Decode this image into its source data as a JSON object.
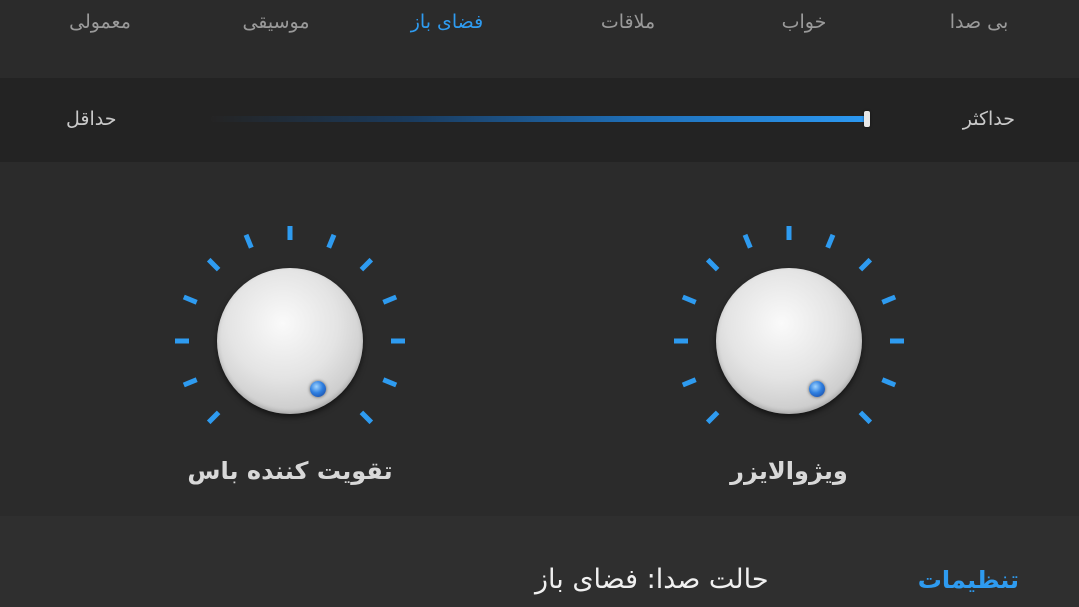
{
  "tabs": [
    {
      "label": "بی صدا",
      "active": false
    },
    {
      "label": "خواب",
      "active": false
    },
    {
      "label": "ملاقات",
      "active": false
    },
    {
      "label": "فضای باز",
      "active": true
    },
    {
      "label": "موسیقی",
      "active": false
    },
    {
      "label": "معمولی",
      "active": false
    }
  ],
  "strength": {
    "min_label": "حداقل",
    "max_label": "حداکثر",
    "value": 1.0
  },
  "knobs": {
    "visualizer_label": "ویژوالایزر",
    "bass_label": "تقویت کننده باس"
  },
  "bottom": {
    "settings_label": "تنظیمات",
    "mode_text": "حالت صدا:  فضای باز"
  },
  "colors": {
    "accent": "#2e9bf0",
    "background": "#2b2b2b",
    "inactive_tab": "#9a9a9a"
  }
}
